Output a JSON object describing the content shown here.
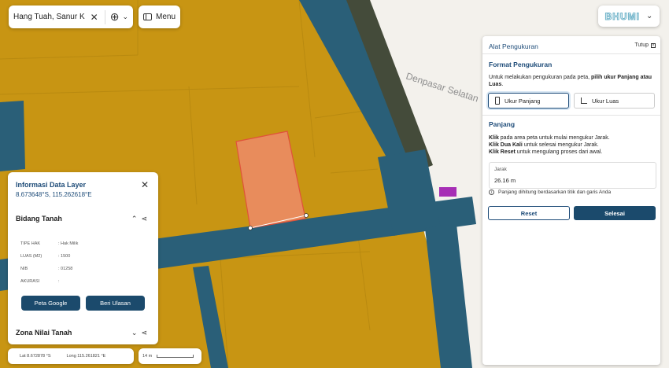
{
  "search": {
    "value": "Hang Tuah, Sanur K"
  },
  "menu": {
    "label": "Menu"
  },
  "brand": {
    "logo": "BHUMI"
  },
  "map": {
    "street_label": "Denpasar Selatan"
  },
  "info_panel": {
    "title": "Informasi Data Layer",
    "coords": "8.673648°S, 115.262618°E",
    "section1": "Bidang Tanah",
    "attributes": [
      {
        "label": "TIPE HAK",
        "value": ": Hak Milik"
      },
      {
        "label": "LUAS (M2)",
        "value": ": 1500"
      },
      {
        "label": "NIB",
        "value": ": 01258"
      },
      {
        "label": "AKURASI",
        "value": ":"
      }
    ],
    "btn_google": "Peta Google",
    "btn_ulasan": "Beri Ulasan",
    "section2": "Zona Nilai Tanah"
  },
  "status": {
    "lat": "Lat 8.672878 °S",
    "lng": "Long 115.261821 °E",
    "scale": "14 m"
  },
  "measure": {
    "title": "Alat Pengukuran",
    "close": "Tutup",
    "format_heading": "Format Pengukuran",
    "format_desc_1": "Untuk melakukan pengukuran pada peta, ",
    "format_desc_bold": "pilih ukur Panjang atau Luas",
    "format_desc_2": ".",
    "mode_panjang": "Ukur Panjang",
    "mode_luas": "Ukur Luas",
    "panjang_heading": "Panjang",
    "instructions": [
      {
        "bold": "Klik",
        "text": " pada area peta untuk mulai mengukur Jarak."
      },
      {
        "bold": "Klik Dua Kali",
        "text": " untuk selesai mengukur Jarak."
      },
      {
        "bold": "Klik Reset",
        "text": " untuk mengulang proses dari awal."
      }
    ],
    "jarak_label": "Jarak",
    "jarak_value": "26.16 m",
    "note": "Panjang dihitung berdasarkan titik dan garis Anda",
    "reset": "Reset",
    "selesai": "Selesai"
  },
  "colors": {
    "parcel": "#c89513",
    "road": "#2a5f78",
    "selected": "#e88c5c",
    "primary": "#1b4a6c"
  }
}
